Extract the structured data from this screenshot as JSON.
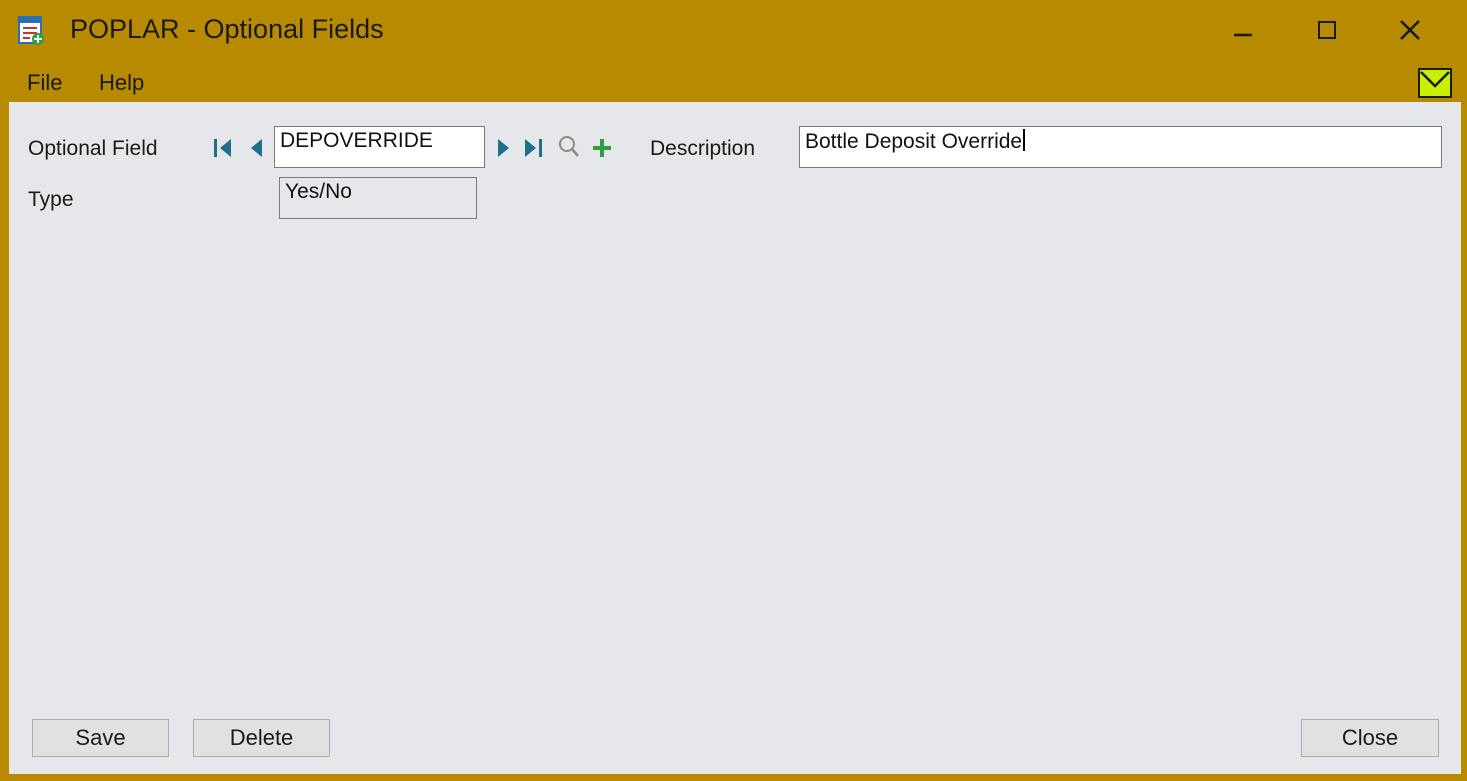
{
  "window": {
    "title": "POPLAR - Optional Fields",
    "titlebar_color": "#b78a00",
    "controls": [
      "minimize-icon",
      "maximize-icon",
      "close-icon"
    ]
  },
  "menu": {
    "file": "File",
    "help": "Help"
  },
  "form": {
    "optional_field_label": "Optional Field",
    "optional_field_value": "DEPOVERRIDE",
    "description_label": "Description",
    "description_value": "Bottle Deposit Override",
    "type_label": "Type",
    "type_value": "Yes/No",
    "nav_icons": [
      "first-record-icon",
      "previous-record-icon",
      "next-record-icon",
      "last-record-icon",
      "finder-icon",
      "new-record-icon"
    ],
    "accent_nav": "#1f6f8b",
    "accent_new": "#2e9e3e"
  },
  "buttons": {
    "save": "Save",
    "delete": "Delete",
    "close": "Close"
  }
}
